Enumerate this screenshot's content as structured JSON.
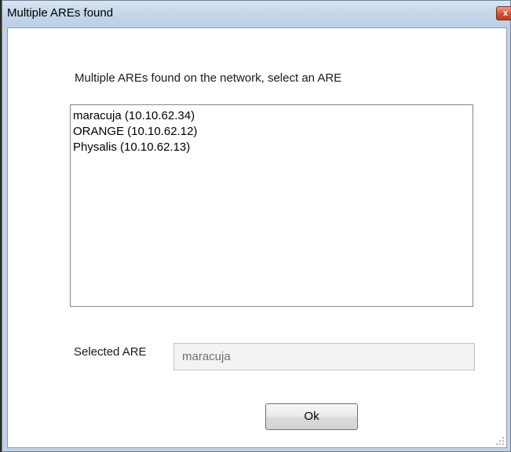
{
  "window": {
    "title": "Multiple AREs found",
    "close_icon": "close-icon",
    "close_glyph": "x"
  },
  "dialog": {
    "prompt": "Multiple AREs found on the network, select an ARE",
    "are_list": [
      "maracuja (10.10.62.34)",
      "ORANGE (10.10.62.12)",
      "Physalis (10.10.62.13)"
    ],
    "selected_label": "Selected ARE",
    "selected_value": "maracuja",
    "ok_label": "Ok"
  },
  "colors": {
    "titlebar": "#c6d7ea",
    "close_button": "#c03a1e",
    "client_background": "#ffffff",
    "disabled_field": "#f3f3f3"
  }
}
